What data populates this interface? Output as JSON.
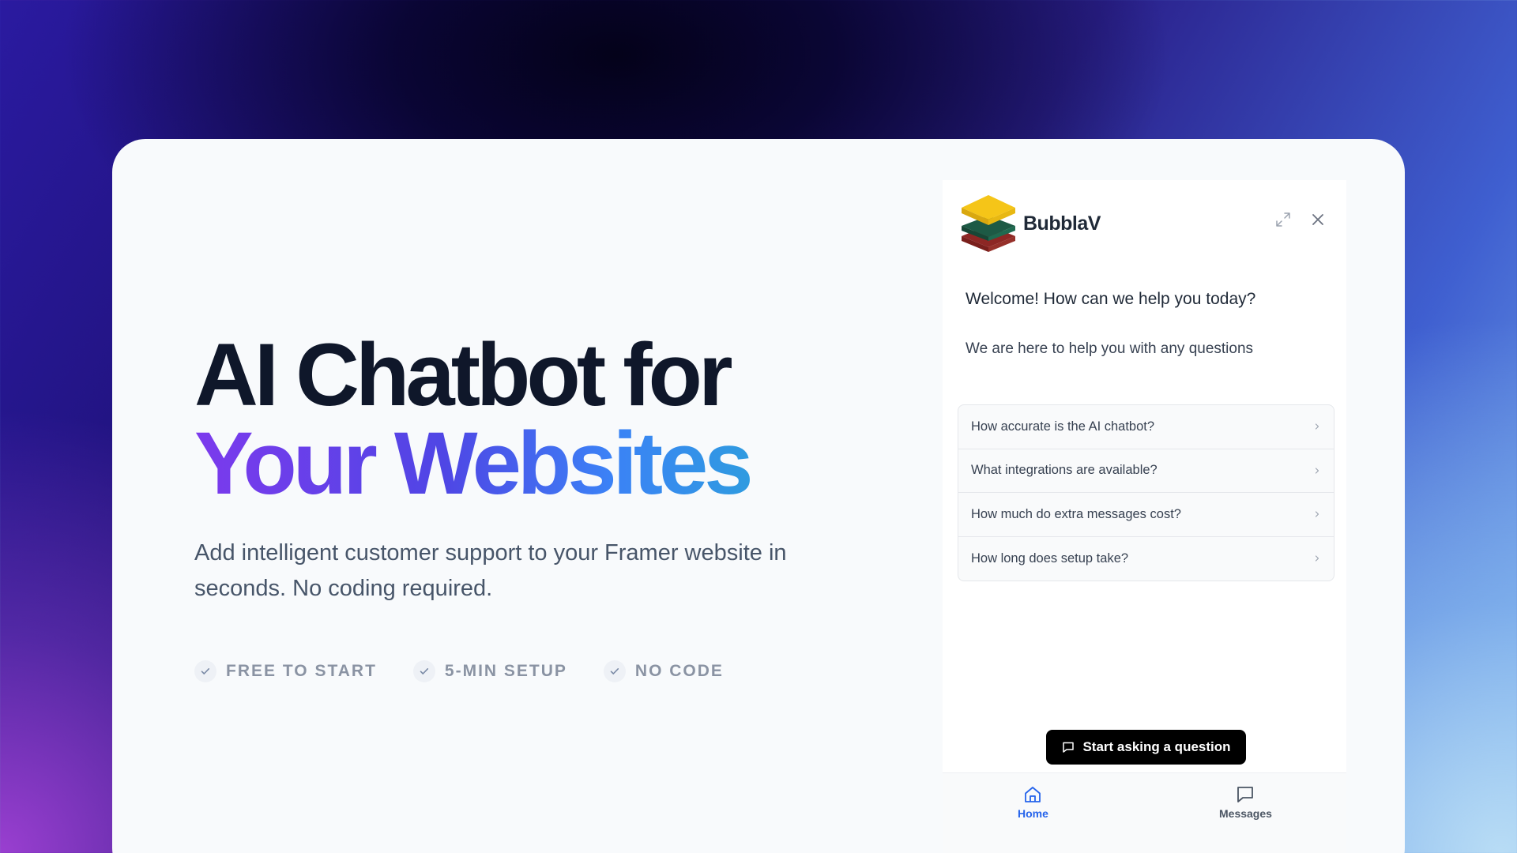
{
  "hero": {
    "title_line1": "AI Chatbot for",
    "title_line2": "Your Websites",
    "subtitle": "Add intelligent customer support to your Framer website in seconds. No coding required.",
    "features": [
      "FREE TO START",
      "5-MIN SETUP",
      "NO CODE"
    ]
  },
  "widget": {
    "brand": "BubblaV",
    "welcome": "Welcome! How can we help you today?",
    "help_text": "We are here to help you with any questions",
    "faq": [
      "How accurate is the AI chatbot?",
      "What integrations are available?",
      "How much do extra messages cost?",
      "How long does setup take?"
    ],
    "cta_label": "Start asking a question",
    "nav": {
      "home": "Home",
      "messages": "Messages"
    }
  },
  "colors": {
    "accent_blue": "#2563eb",
    "gradient_start": "#7c3aed",
    "gradient_end": "#2f9be0",
    "logo_yellow": "#f5c518",
    "logo_green": "#1f5e48",
    "logo_red": "#a8322d"
  }
}
